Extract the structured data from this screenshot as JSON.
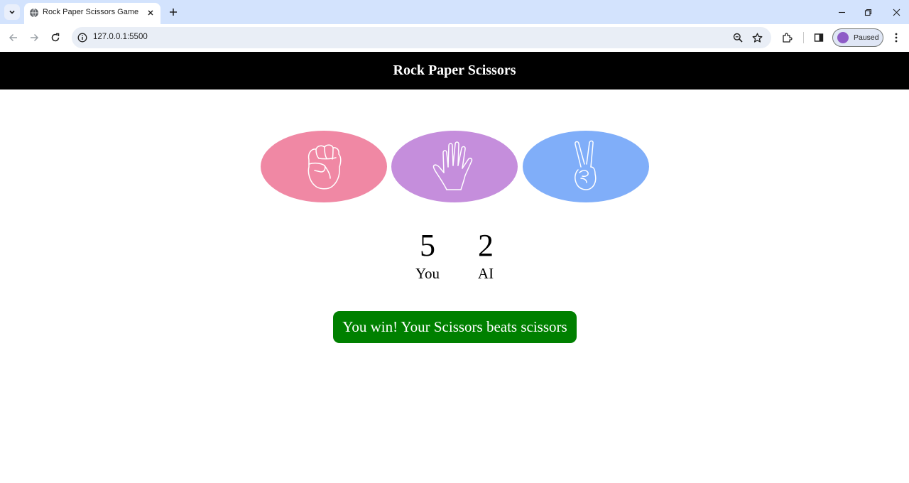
{
  "browser": {
    "tab": {
      "title": "Rock Paper Scissors Game"
    },
    "address_bar": {
      "url": "127.0.0.1:5500"
    },
    "profile": {
      "label": "Paused"
    }
  },
  "game": {
    "title": "Rock Paper Scissors",
    "choices": [
      {
        "name": "rock",
        "color": "#f088a4"
      },
      {
        "name": "paper",
        "color": "#c58edc"
      },
      {
        "name": "scissors",
        "color": "#80aef9"
      }
    ],
    "score": {
      "player": {
        "value": "5",
        "label": "You"
      },
      "ai": {
        "value": "2",
        "label": "AI"
      }
    },
    "result": {
      "message": "You win! Your Scissors beats scissors",
      "color": "#008000"
    }
  }
}
